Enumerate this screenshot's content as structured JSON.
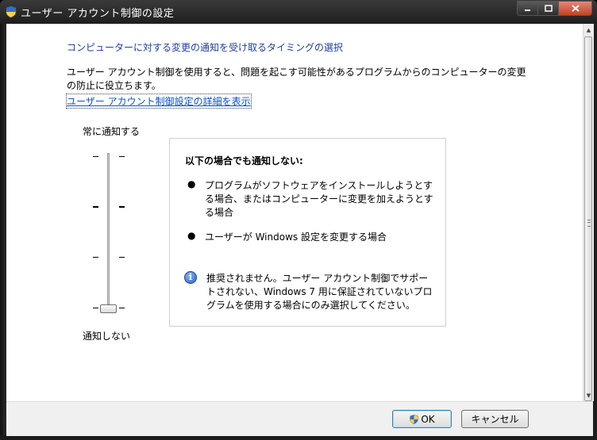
{
  "window": {
    "title": "ユーザー アカウント制御の設定"
  },
  "content": {
    "heading": "コンピューターに対する変更の通知を受け取るタイミングの選択",
    "description": "ユーザー アカウント制御を使用すると、問題を起こす可能性があるプログラムからのコンピューターの変更の防止に役立ちます。",
    "link": "ユーザー アカウント制御設定の詳細を表示"
  },
  "slider": {
    "top_label": "常に通知する",
    "bottom_label": "通知しない",
    "levels": 4,
    "selected_level": 1
  },
  "info": {
    "title": "以下の場合でも通知しない:",
    "bullets": [
      "プログラムがソフトウェアをインストールしようとする場合、またはコンピューターに変更を加えようとする場合",
      "ユーザーが Windows 設定を変更する場合"
    ],
    "warning": "推奨されません。ユーザー アカウント制御でサポートされない、Windows 7 用に保証されていないプログラムを使用する場合にのみ選択してください。"
  },
  "buttons": {
    "ok": "OK",
    "cancel": "キャンセル"
  },
  "colors": {
    "heading": "#1e3f9e",
    "link": "#0a53c4",
    "close_button": "#c3421f"
  }
}
